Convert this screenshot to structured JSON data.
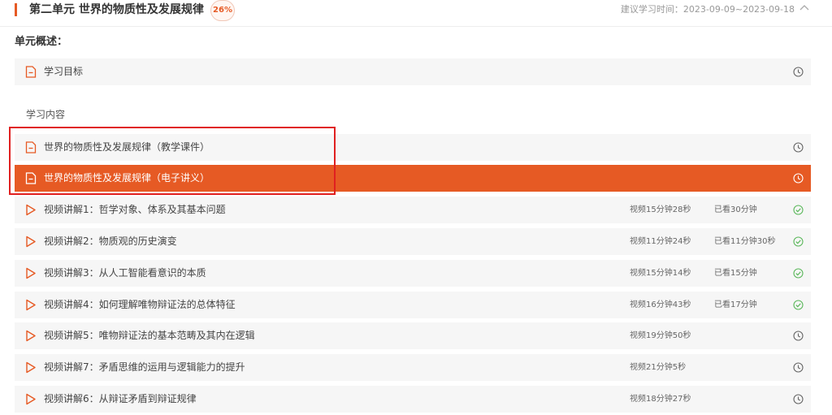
{
  "header": {
    "unit_title": "第二单元 世界的物质性及发展规律",
    "progress": "26%",
    "progress_value": 0.26,
    "study_time": "建议学习时间：2023-09-09~2023-09-18"
  },
  "overview": {
    "label": "单元概述：",
    "goal": {
      "label": "学习目标",
      "icon": "document-icon",
      "status_icon": "clock-icon"
    }
  },
  "content": {
    "label": "学习内容",
    "docs": [
      {
        "label": "世界的物质性及发展规律（教学课件）",
        "icon": "document-icon",
        "status_icon": "clock-icon",
        "active": false
      },
      {
        "label": "世界的物质性及发展规律（电子讲义）",
        "icon": "document-icon",
        "status_icon": "clock-icon",
        "active": true
      }
    ],
    "videos": [
      {
        "label": "视频讲解1：哲学对象、体系及其基本问题",
        "duration": "视频15分钟28秒",
        "watched": "已看30分钟",
        "status": "completed"
      },
      {
        "label": "视频讲解2：物质观的历史演变",
        "duration": "视频11分钟24秒",
        "watched": "已看11分钟30秒",
        "status": "completed"
      },
      {
        "label": "视频讲解3：从人工智能看意识的本质",
        "duration": "视频15分钟14秒",
        "watched": "已看15分钟",
        "status": "completed"
      },
      {
        "label": "视频讲解4：如何理解唯物辩证法的总体特征",
        "duration": "视频16分钟43秒",
        "watched": "已看17分钟",
        "status": "completed"
      },
      {
        "label": "视频讲解5：唯物辩证法的基本范畴及其内在逻辑",
        "duration": "视频19分钟50秒",
        "watched": "",
        "status": "pending"
      },
      {
        "label": "视频讲解7：矛盾思维的运用与逻辑能力的提升",
        "duration": "视频21分钟5秒",
        "watched": "",
        "status": "pending"
      },
      {
        "label": "视频讲解6：从辩证矛盾到辩证规律",
        "duration": "视频18分钟27秒",
        "watched": "",
        "status": "pending"
      }
    ]
  },
  "colors": {
    "accent": "#e65a24",
    "completed": "#5cb85c",
    "annotation": "#e02020"
  }
}
